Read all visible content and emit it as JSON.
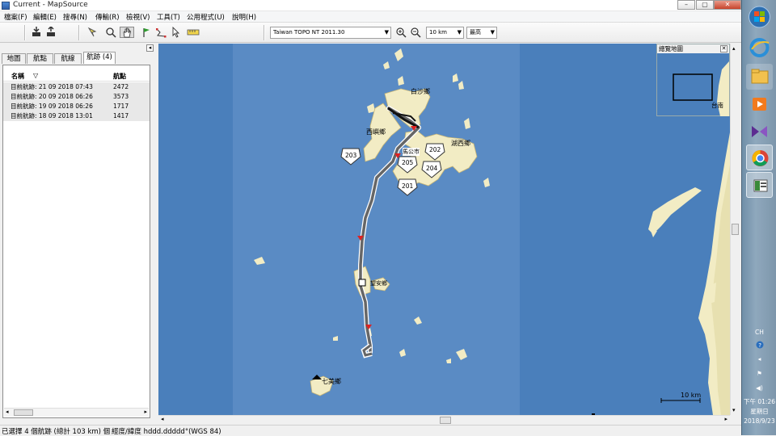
{
  "window": {
    "title": "Current - MapSource",
    "controls": [
      "–",
      "▢",
      "✕"
    ]
  },
  "menu": [
    "檔案(F)",
    "編輯(E)",
    "搜尋(N)",
    "傳輸(R)",
    "檢視(V)",
    "工具(T)",
    "公用程式(U)",
    "說明(H)"
  ],
  "toolbar": {
    "map_product": "Taiwan TOPO NT 2011.30",
    "zoom_level": "10 km",
    "detail": "最高"
  },
  "left_panel": {
    "tabs": [
      "地圖",
      "航點",
      "航線",
      "航跡 (4)"
    ],
    "active_tab": 3,
    "columns": {
      "name": "名稱",
      "points": "航點"
    },
    "rows": [
      {
        "name": "目前航跡: 21 09 2018 07:43",
        "points": "2472"
      },
      {
        "name": "目前航跡: 20 09 2018 06:26",
        "points": "3573"
      },
      {
        "name": "目前航跡: 19 09 2018 06:26",
        "points": "1717"
      },
      {
        "name": "目前航跡: 18 09 2018 13:01",
        "points": "1417"
      }
    ]
  },
  "map": {
    "labels": [
      "白沙鄉",
      "西嶼鄉",
      "馬公市",
      "湖西鄉",
      "望安鄉",
      "七美鄉",
      "台南"
    ],
    "route_shields": [
      "203",
      "202",
      "205",
      "204",
      "201"
    ],
    "overview_title": "總覽地圖",
    "scale_label": "10 km",
    "colors": {
      "sea": "#4a7fbb",
      "land": "#f2ecc4",
      "track": "#222222"
    }
  },
  "status": {
    "left": "已選擇 4 個航跡 (總計 103 km) 個",
    "middle": "經度/緯度 hddd.ddddd°(WGS 84)"
  },
  "taskbar": {
    "lang": "CH",
    "time": "下午 01:26",
    "weekday": "星期日",
    "date": "2018/9/23"
  }
}
